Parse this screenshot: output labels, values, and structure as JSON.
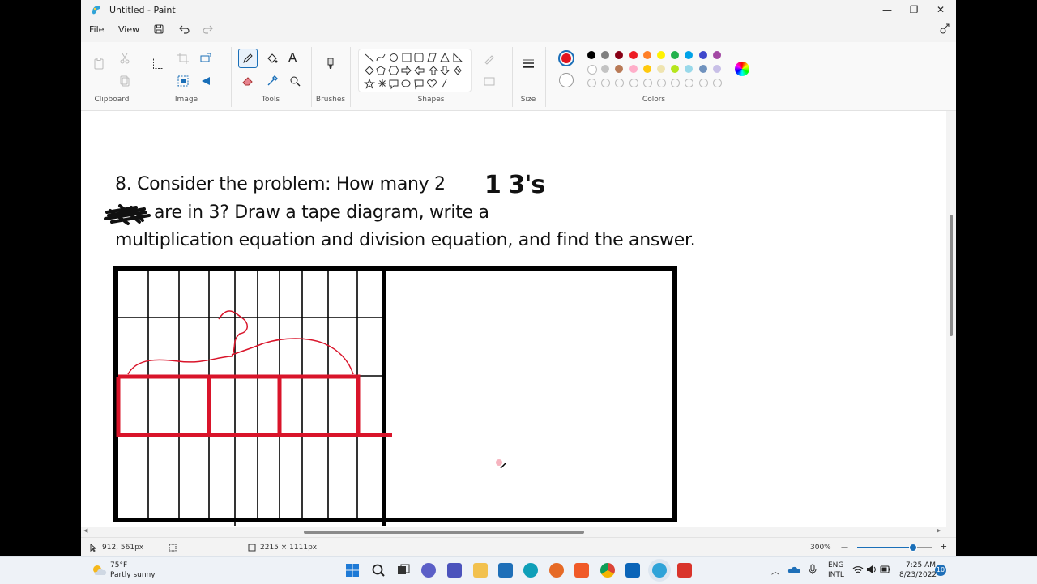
{
  "window": {
    "title": "Untitled - Paint",
    "minimize": "—",
    "maximize": "❐",
    "close": "✕"
  },
  "menu": {
    "file": "File",
    "view": "View"
  },
  "ribbon": {
    "groups": {
      "clipboard": "Clipboard",
      "image": "Image",
      "tools": "Tools",
      "brushes": "Brushes",
      "shapes": "Shapes",
      "size": "Size",
      "colors": "Colors"
    },
    "text_tool": "A",
    "primary_color": "#e2141f",
    "secondary_color": "#ffffff",
    "palette_row1": [
      "#000000",
      "#7f7f7f",
      "#880015",
      "#ed1c24",
      "#ff7f27",
      "#fff200",
      "#22b14c",
      "#00a2e8",
      "#3f48cc",
      "#a349a4"
    ],
    "palette_row2": [
      "#ffffff",
      "#c3c3c3",
      "#b97a57",
      "#ffaec9",
      "#ffc90e",
      "#efe4b0",
      "#b5e61d",
      "#99d9ea",
      "#7092be",
      "#c8bfe7"
    ]
  },
  "canvas": {
    "line1": "8. Consider the problem: How many 2",
    "line1_handwritten": "1 3's",
    "line2": "are in 3? Draw a tape diagram, write a",
    "line3": "multiplication equation and division equation, and find the answer.",
    "ink_color": "#d9142a"
  },
  "status": {
    "cursor_pos": "912, 561px",
    "canvas_size": "2215 × 1111px",
    "zoom": "300%",
    "zoom_minus": "—",
    "zoom_plus": "+",
    "zoom_level": 0.75
  },
  "taskbar": {
    "weather_temp": "75°F",
    "weather_desc": "Partly sunny",
    "lang1": "ENG",
    "lang2": "INTL",
    "time": "7:25 AM",
    "date": "8/23/2022",
    "notifications": "10"
  }
}
